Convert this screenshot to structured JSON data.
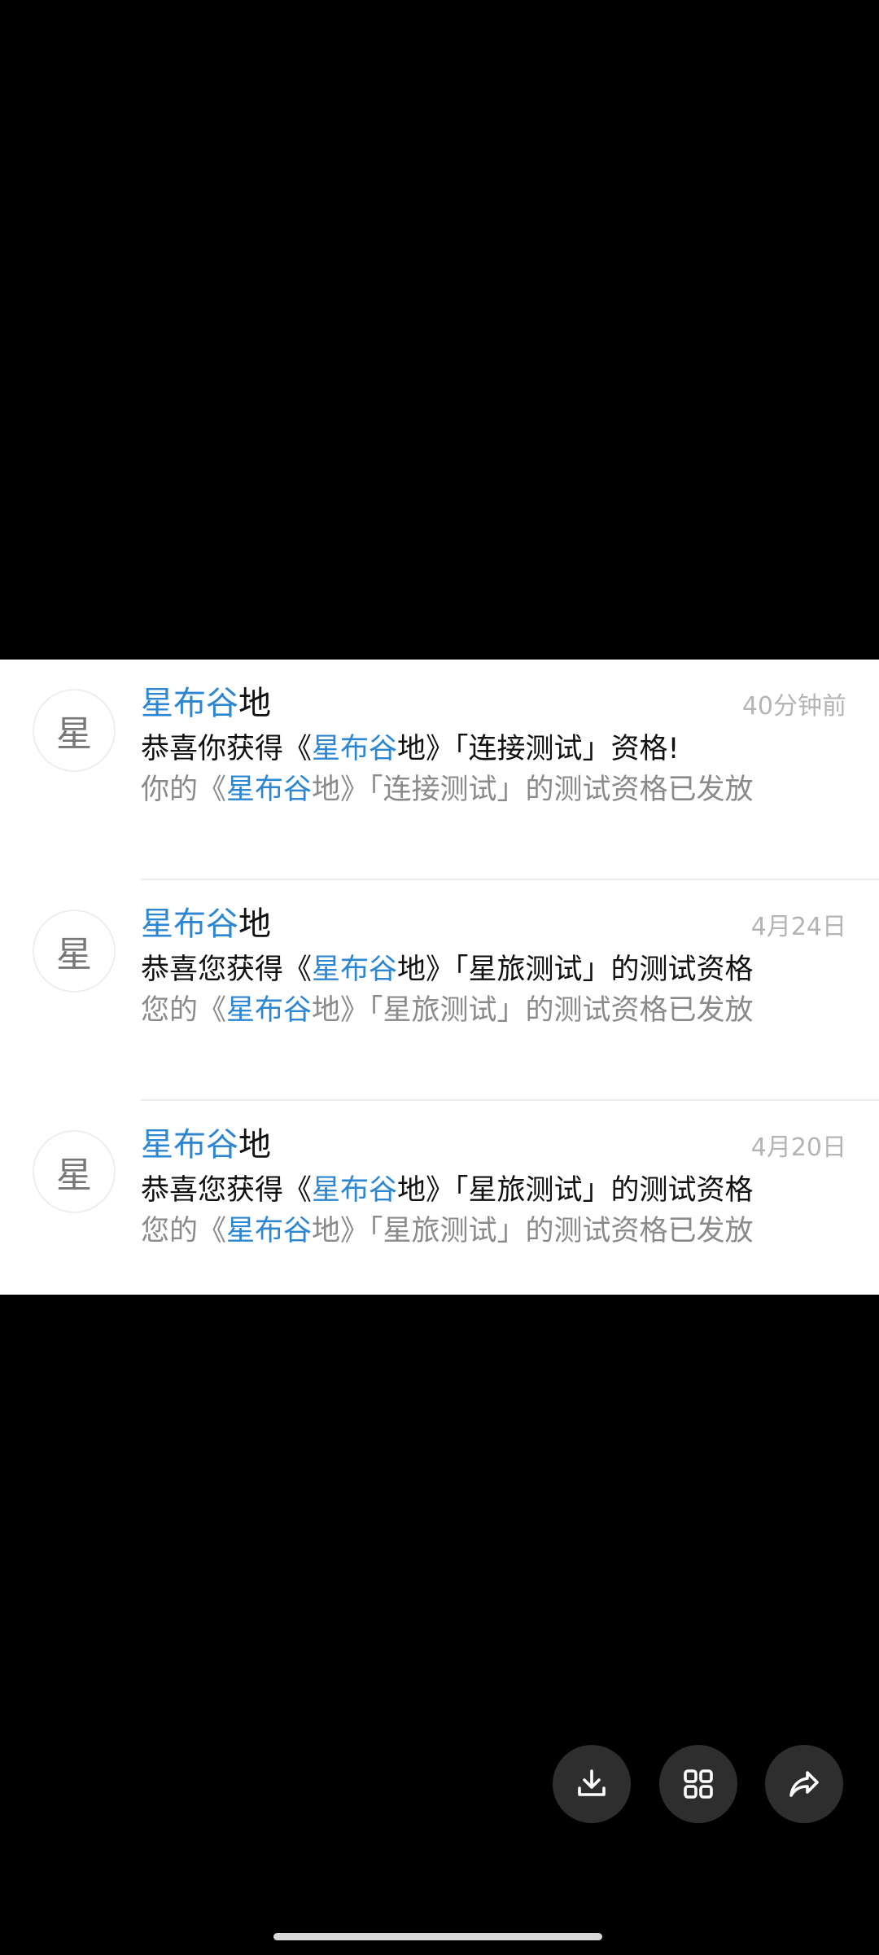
{
  "messages": [
    {
      "avatar_char": "星",
      "sender_hl": "星布谷",
      "sender_rest": "地",
      "time": "40分钟前",
      "title_pre": "恭喜你获得《",
      "title_hl": "星布谷",
      "title_post": "地》「连接测试」资格!",
      "preview_pre": "你的《",
      "preview_hl": "星布谷",
      "preview_post": "地》「连接测试」的测试资格已发放"
    },
    {
      "avatar_char": "星",
      "sender_hl": "星布谷",
      "sender_rest": "地",
      "time": "4月24日",
      "title_pre": "恭喜您获得《",
      "title_hl": "星布谷",
      "title_post": "地》「星旅测试」的测试资格",
      "preview_pre": "您的《",
      "preview_hl": "星布谷",
      "preview_post": "地》「星旅测试」的测试资格已发放"
    },
    {
      "avatar_char": "星",
      "sender_hl": "星布谷",
      "sender_rest": "地",
      "time": "4月20日",
      "title_pre": "恭喜您获得《",
      "title_hl": "星布谷",
      "title_post": "地》「星旅测试」的测试资格",
      "preview_pre": "您的《",
      "preview_hl": "星布谷",
      "preview_post": "地》「星旅测试」的测试资格已发放"
    }
  ],
  "toolbar": {
    "buttons": [
      {
        "icon": "download-icon"
      },
      {
        "icon": "grid-icon"
      },
      {
        "icon": "share-icon"
      }
    ]
  },
  "colors": {
    "highlight": "#2c86d2",
    "background": "#000000",
    "card": "#ffffff",
    "fab": "#2e2e2e"
  }
}
